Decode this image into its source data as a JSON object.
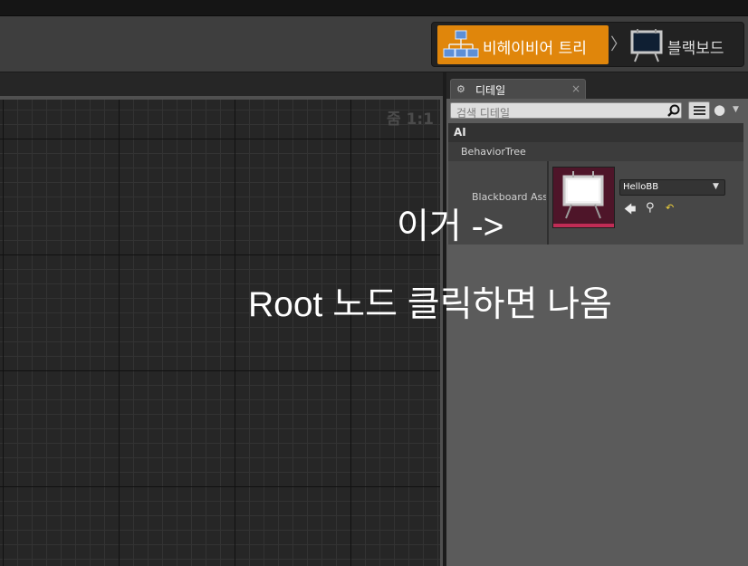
{
  "mode_switcher": {
    "behavior_tree_label": "비헤이비어 트리",
    "blackboard_label": "블랙보드",
    "separator": "〉"
  },
  "graph": {
    "zoom_label": "줌 1:1"
  },
  "details": {
    "tab_label": "디테일",
    "tab_icon": "gear-icon",
    "close_glyph": "×",
    "search_placeholder": "검색 디테일",
    "categories": {
      "ai": "AI",
      "behavior_tree": "BehaviorTree"
    },
    "blackboard_asset": {
      "property_name": "Blackboard Asset",
      "value": "HelloBB"
    }
  },
  "annotation": {
    "line1": "이거 ->",
    "line2": "Root 노드 클릭하면 나옴"
  },
  "colors": {
    "accent_orange": "#e0860b",
    "thumbnail_bg": "#4e1529",
    "thumbnail_strip": "#c02c55"
  }
}
